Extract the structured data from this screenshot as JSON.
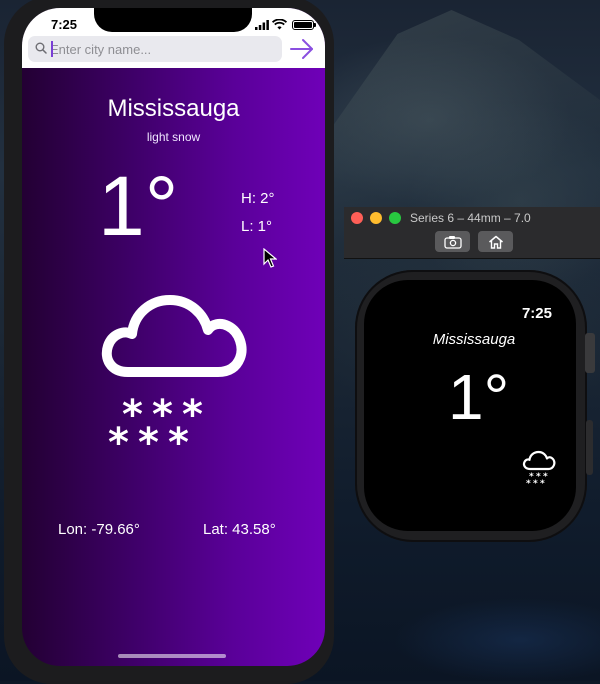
{
  "phone": {
    "status_time": "7:25",
    "search": {
      "placeholder": "Enter city name...",
      "value": ""
    },
    "city": "Mississauga",
    "condition": "light snow",
    "temperature": "1°",
    "high": "H: 2°",
    "low": "L: 1°",
    "weather_icon": "cloud-snow-icon",
    "longitude": "Lon: -79.66°",
    "latitude": "Lat: 43.58°",
    "gradient": [
      "#230033",
      "#6f00b8"
    ],
    "accent": "#8a4fe0"
  },
  "simulator": {
    "title": "Series 6 – 44mm – 7.0",
    "buttons": [
      "camera-icon",
      "home-icon"
    ]
  },
  "watch": {
    "time": "7:25",
    "city": "Mississauga",
    "temperature": "1°",
    "weather_icon": "cloud-snow-icon"
  }
}
